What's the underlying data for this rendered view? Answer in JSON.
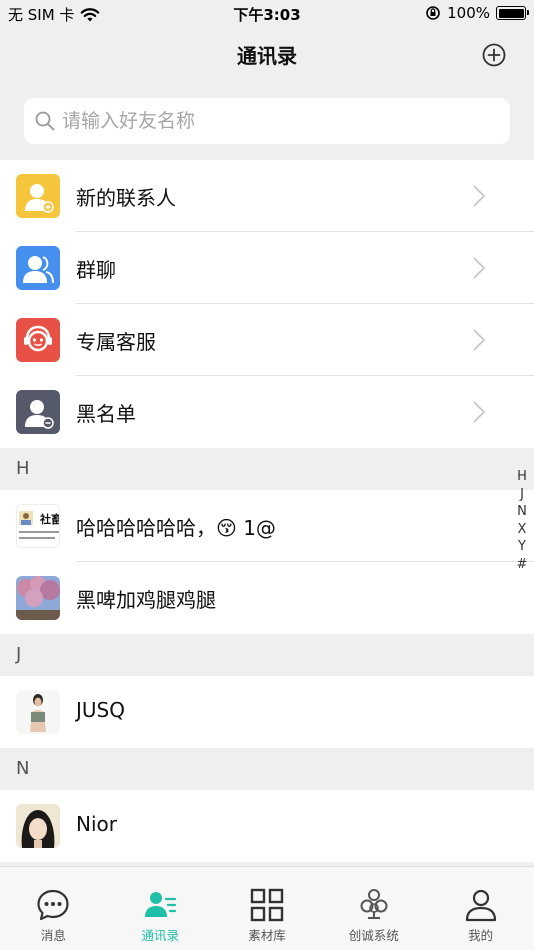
{
  "status_bar": {
    "carrier": "无 SIM 卡",
    "time": "下午3:03",
    "battery_percent": "100%",
    "battery_level": 1.0
  },
  "header": {
    "title": "通讯录",
    "add_icon": "plus-circle-icon"
  },
  "search": {
    "placeholder": "请输入好友名称"
  },
  "functions": [
    {
      "label": "新的联系人",
      "icon": "new-contact-icon",
      "color": "#f5c53b"
    },
    {
      "label": "群聊",
      "icon": "group-chat-icon",
      "color": "#4590ee"
    },
    {
      "label": "专属客服",
      "icon": "customer-service-icon",
      "color": "#e85246"
    },
    {
      "label": "黑名单",
      "icon": "blacklist-icon",
      "color": "#56596a"
    }
  ],
  "sections": [
    {
      "letter": "H",
      "contacts": [
        {
          "name": "哈哈哈哈哈哈，😚 1@",
          "avatar_text": "社畜"
        },
        {
          "name": "黑啤加鸡腿鸡腿"
        }
      ]
    },
    {
      "letter": "J",
      "contacts": [
        {
          "name": "JUSQ"
        }
      ]
    },
    {
      "letter": "N",
      "contacts": [
        {
          "name": "Nior"
        }
      ]
    }
  ],
  "index_letters": [
    "H",
    "J",
    "N",
    "X",
    "Y",
    "#"
  ],
  "tabs": [
    {
      "label": "消息",
      "icon": "chat-bubble-icon"
    },
    {
      "label": "通讯录",
      "icon": "contacts-icon",
      "active": true
    },
    {
      "label": "素材库",
      "icon": "grid-icon"
    },
    {
      "label": "创诚系统",
      "icon": "system-logo-icon"
    },
    {
      "label": "我的",
      "icon": "profile-icon"
    }
  ],
  "colors": {
    "accent": "#20c0a8",
    "background": "#efefef"
  }
}
